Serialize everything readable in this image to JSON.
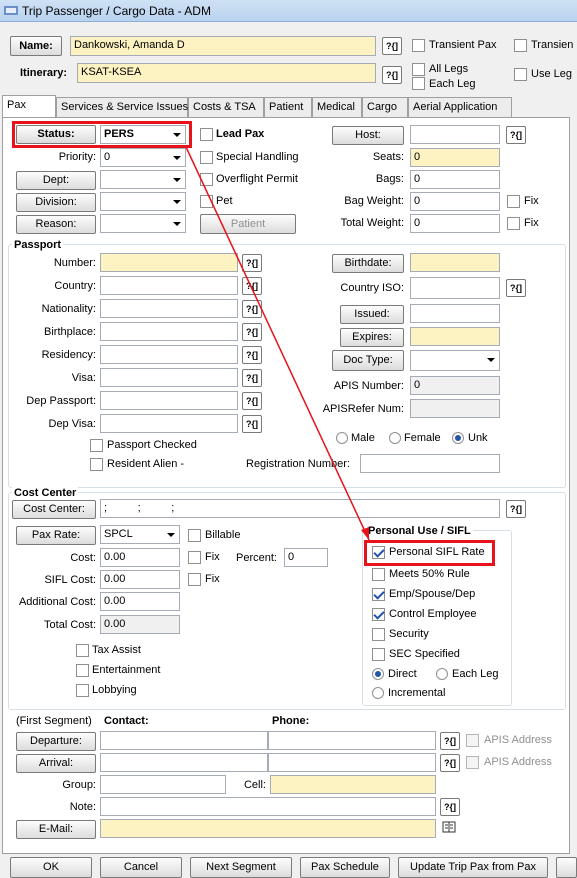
{
  "window": {
    "title": "Trip Passenger / Cargo Data - ADM"
  },
  "header": {
    "name_button": "Name:",
    "name_value": "Dankowski, Amanda D",
    "itinerary_label": "Itinerary:",
    "itinerary_value": "KSAT-KSEA",
    "help_icon": "?{]",
    "transient_pax": "Transient Pax",
    "transient_cut": "Transien",
    "all_legs": "All Legs",
    "each_leg": "Each Leg",
    "use_leg": "Use Leg"
  },
  "tabs": [
    "Pax",
    "Services & Service Issues",
    "Costs & TSA",
    "Patient",
    "Medical",
    "Cargo",
    "Aerial Application"
  ],
  "pax": {
    "status_button": "Status:",
    "status_value": "PERS",
    "lead_pax": "Lead Pax",
    "host_button": "Host:",
    "priority_label": "Priority:",
    "priority_value": "0",
    "special_handling": "Special Handling",
    "seats_label": "Seats:",
    "seats_value": "0",
    "dept_button": "Dept:",
    "overflight_permit": "Overflight Permit",
    "bags_label": "Bags:",
    "bags_value": "0",
    "division_button": "Division:",
    "pet": "Pet",
    "bag_weight_label": "Bag Weight:",
    "bag_weight_value": "0",
    "fix": "Fix",
    "reason_button": "Reason:",
    "patient_button": "Patient",
    "total_weight_label": "Total Weight:",
    "total_weight_value": "0"
  },
  "passport": {
    "title": "Passport",
    "number": "Number:",
    "country": "Country:",
    "nationality": "Nationality:",
    "birthplace": "Birthplace:",
    "residency": "Residency:",
    "visa": "Visa:",
    "dep_passport": "Dep Passport:",
    "dep_visa": "Dep Visa:",
    "birthdate_button": "Birthdate:",
    "country_iso": "Country ISO:",
    "issued_button": "Issued:",
    "expires_button": "Expires:",
    "doc_type_button": "Doc Type:",
    "apis_number_label": "APIS Number:",
    "apis_number_value": "0",
    "apis_refer": "APISRefer Num:",
    "male": "Male",
    "female": "Female",
    "unk": "Unk",
    "passport_checked": "Passport Checked",
    "resident_alien": "Resident Alien  -",
    "registration_number": "Registration Number:"
  },
  "cost": {
    "title": "Cost Center",
    "cost_center_button": "Cost Center:",
    "cost_center_value": ";          ;          ;",
    "pax_rate_button": "Pax Rate:",
    "pax_rate_value": "SPCL",
    "billable": "Billable",
    "cost_label": "Cost:",
    "cost_value": "0.00",
    "fix": "Fix",
    "percent_label": "Percent:",
    "percent_value": "0",
    "sifl_cost_label": "SIFL Cost:",
    "sifl_cost_value": "0.00",
    "additional_cost_label": "Additional Cost:",
    "additional_cost_value": "0.00",
    "total_cost_label": "Total Cost:",
    "total_cost_value": "0.00",
    "tax_assist": "Tax Assist",
    "entertainment": "Entertainment",
    "lobbying": "Lobbying"
  },
  "sifl": {
    "title": "Personal Use / SIFL",
    "personal_sifl_rate": "Personal SIFL Rate",
    "meets_50": "Meets 50% Rule",
    "emp_spouse": "Emp/Spouse/Dep",
    "control_employee": "Control Employee",
    "security": "Security",
    "sec_specified": "SEC Specified",
    "direct": "Direct",
    "each_leg": "Each Leg",
    "incremental": "Incremental"
  },
  "segment": {
    "first_segment": "(First Segment)",
    "contact": "Contact:",
    "phone": "Phone:",
    "departure_button": "Departure:",
    "arrival_button": "Arrival:",
    "apis_address": "APIS Address",
    "group_label": "Group:",
    "cell_label": "Cell:",
    "note_label": "Note:",
    "email_button": "E-Mail:"
  },
  "footer": {
    "ok": "OK",
    "cancel": "Cancel",
    "next_segment": "Next Segment",
    "pax_schedule": "Pax Schedule",
    "update_trip_pax": "Update Trip Pax from Pax"
  },
  "annotation": {
    "color": "#e8121b"
  }
}
